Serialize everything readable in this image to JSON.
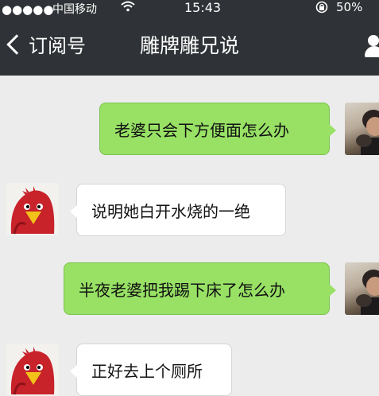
{
  "status_bar": {
    "signal": "●●●●●",
    "carrier": "中国移动",
    "wifi_icon": "wifi-icon",
    "time": "15:43",
    "lock_icon": "rotation-lock-icon",
    "battery": "50%"
  },
  "nav": {
    "back_label": "订阅号",
    "title": "雕牌雕兄说",
    "profile_icon": "person-icon"
  },
  "messages": [
    {
      "from": "me",
      "text": "老婆只会下方便面怎么办"
    },
    {
      "from": "account",
      "text": "说明她白开水烧的一绝"
    },
    {
      "from": "me",
      "text": "半夜老婆把我踢下床了怎么办"
    },
    {
      "from": "account",
      "text": "正好去上个厕所"
    }
  ],
  "colors": {
    "header": "#2f3236",
    "background": "#ececec",
    "sent_bubble": "#98e165",
    "received_bubble": "#ffffff"
  }
}
